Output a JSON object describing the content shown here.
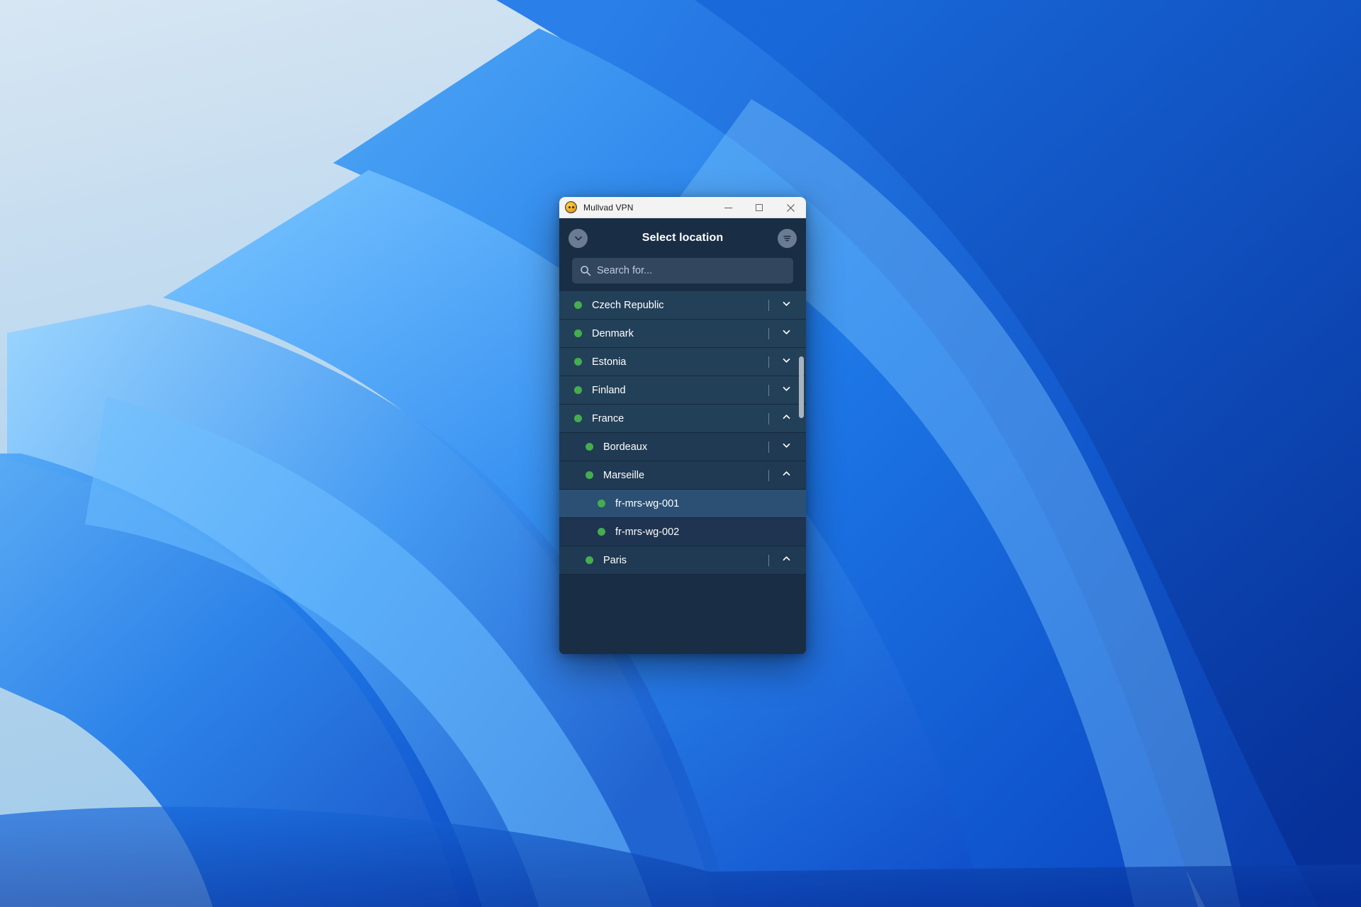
{
  "window": {
    "title": "Mullvad VPN",
    "app_icon": "mullvad-mole-icon",
    "controls": {
      "minimize": "minimize-icon",
      "maximize": "maximize-icon",
      "close": "close-icon"
    }
  },
  "header": {
    "title": "Select location",
    "back_icon": "chevron-down-icon",
    "filter_icon": "filter-icon"
  },
  "search": {
    "placeholder": "Search for...",
    "value": "",
    "icon": "search-icon"
  },
  "colors": {
    "accent_blue": "#192e45",
    "row_country": "#234059",
    "row_city": "#1f3a52",
    "row_server": "#1e3450",
    "row_highlight": "#2c5073",
    "status_green": "#44ad4d",
    "titlebar": "#f3f3f3",
    "search_field": "#32465e",
    "scrollbar_thumb": "#a9b4c2"
  },
  "list": {
    "rows": [
      {
        "label": "Czech Republic",
        "level": "country",
        "status": "online",
        "expandable": true,
        "expanded": false,
        "highlighted": false
      },
      {
        "label": "Denmark",
        "level": "country",
        "status": "online",
        "expandable": true,
        "expanded": false,
        "highlighted": false
      },
      {
        "label": "Estonia",
        "level": "country",
        "status": "online",
        "expandable": true,
        "expanded": false,
        "highlighted": false
      },
      {
        "label": "Finland",
        "level": "country",
        "status": "online",
        "expandable": true,
        "expanded": false,
        "highlighted": false
      },
      {
        "label": "France",
        "level": "country",
        "status": "online",
        "expandable": true,
        "expanded": true,
        "highlighted": false
      },
      {
        "label": "Bordeaux",
        "level": "city",
        "status": "online",
        "expandable": true,
        "expanded": false,
        "highlighted": false
      },
      {
        "label": "Marseille",
        "level": "city",
        "status": "online",
        "expandable": true,
        "expanded": true,
        "highlighted": false
      },
      {
        "label": "fr-mrs-wg-001",
        "level": "server",
        "status": "online",
        "expandable": false,
        "expanded": false,
        "highlighted": true
      },
      {
        "label": "fr-mrs-wg-002",
        "level": "server",
        "status": "online",
        "expandable": false,
        "expanded": false,
        "highlighted": false
      },
      {
        "label": "Paris",
        "level": "city",
        "status": "online",
        "expandable": true,
        "expanded": true,
        "highlighted": false
      }
    ],
    "scrollbar": {
      "thumb_top_percent": 18,
      "thumb_height_percent": 17
    }
  }
}
